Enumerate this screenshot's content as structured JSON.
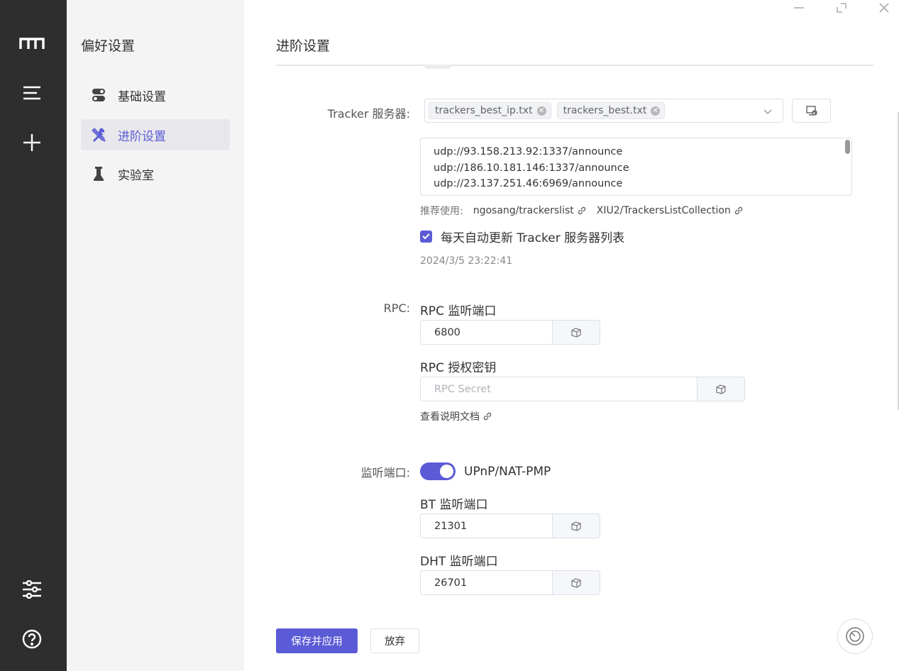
{
  "sidebar": {
    "icons": [
      "logo-icon",
      "task-list-icon",
      "add-task-icon",
      "preferences-icon",
      "help-icon"
    ]
  },
  "menu": {
    "title": "偏好设置",
    "items": [
      {
        "label": "基础设置",
        "icon": "toggle-icon",
        "active": false
      },
      {
        "label": "进阶设置",
        "icon": "tools-icon",
        "active": true
      },
      {
        "label": "实验室",
        "icon": "flask-icon",
        "active": false
      }
    ]
  },
  "page": {
    "title": "进阶设置"
  },
  "tracker": {
    "label": "Tracker 服务器:",
    "tags": [
      "trackers_best_ip.txt",
      "trackers_best.txt"
    ],
    "urls": [
      "udp://93.158.213.92:1337/announce",
      "udp://186.10.181.146:1337/announce",
      "udp://23.137.251.46:6969/announce"
    ],
    "recommend_prefix": "推荐使用:",
    "recommend_links": [
      "ngosang/trackerslist",
      "XIU2/TrackersListCollection"
    ],
    "auto_update_label": "每天自动更新 Tracker 服务器列表",
    "auto_update_checked": true,
    "last_updated": "2024/3/5 23:22:41"
  },
  "rpc": {
    "label": "RPC:",
    "port_title": "RPC 监听端口",
    "port_value": "6800",
    "secret_title": "RPC 授权密钥",
    "secret_placeholder": "RPC Secret",
    "doc_link": "查看说明文档"
  },
  "listen": {
    "label": "监听端口:",
    "upnp_label": "UPnP/NAT-PMP",
    "upnp_enabled": true,
    "bt_title": "BT 监听端口",
    "bt_value": "21301",
    "dht_title": "DHT 监听端口",
    "dht_value": "26701"
  },
  "actions": {
    "save_label": "保存并应用",
    "discard_label": "放弃"
  },
  "colors": {
    "accent": "#5b5bd6",
    "rail": "#2e2e2e",
    "menu_bg": "#f4f4f4"
  }
}
